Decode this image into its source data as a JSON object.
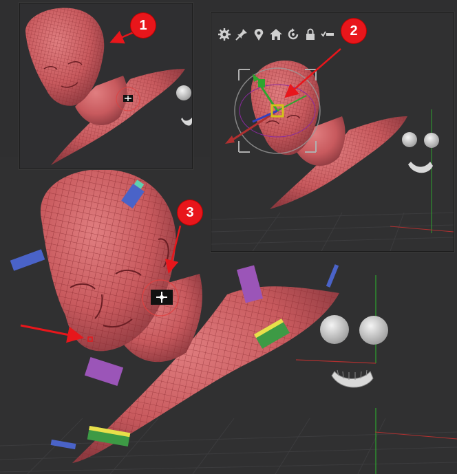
{
  "callouts": {
    "one": "1",
    "two": "2",
    "three": "3"
  },
  "toolbar": {
    "icons": [
      "gear-icon",
      "pin-icon",
      "location-icon",
      "home-icon",
      "reset-icon",
      "lock-icon",
      "checklist-icon"
    ]
  },
  "colors": {
    "background": "#2f2f30",
    "mesh": "#c85a5e",
    "wire": "#8a2a30",
    "callout": "#e8161b",
    "grid": "#3c3c3e",
    "axis_red": "#b03030",
    "axis_green": "#2ea52e",
    "gizmo_yellow": "#d4c21a"
  }
}
